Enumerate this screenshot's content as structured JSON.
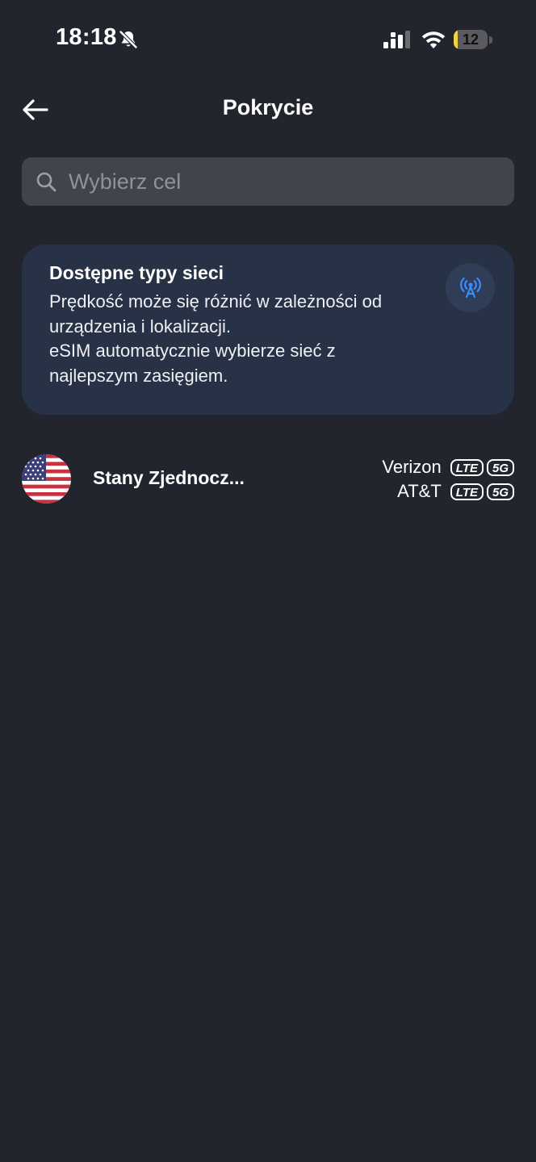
{
  "status_bar": {
    "time": "18:18",
    "battery_level": "12",
    "battery_fraction": 0.12,
    "icons": [
      "bell-slash-icon",
      "cellular-signal-icon",
      "wifi-icon",
      "battery-icon"
    ]
  },
  "header": {
    "title": "Pokrycie",
    "back_icon": "arrow-left-icon"
  },
  "search": {
    "placeholder": "Wybierz cel",
    "value": "",
    "icon": "search-icon"
  },
  "info_card": {
    "title": "Dostępne typy sieci",
    "lines": [
      "Prędkość może się różnić w zależności od",
      "urządzenia i lokalizacji.",
      "eSIM automatycznie wybierze sieć z",
      "najlepszym zasięgiem."
    ],
    "icon": "antenna-icon",
    "icon_color": "#3d8bff"
  },
  "coverage": [
    {
      "country": "Stany Zjednocz...",
      "flag": "us-flag-icon",
      "carriers": [
        {
          "name": "Verizon",
          "networks": [
            "LTE",
            "5G"
          ]
        },
        {
          "name": "AT&T",
          "networks": [
            "LTE",
            "5G"
          ]
        }
      ]
    }
  ],
  "colors": {
    "background": "#22252e",
    "search_bg": "#40444d",
    "card_bg": "#283246",
    "accent": "#3d8bff",
    "battery_fill": "#f2d43d"
  }
}
